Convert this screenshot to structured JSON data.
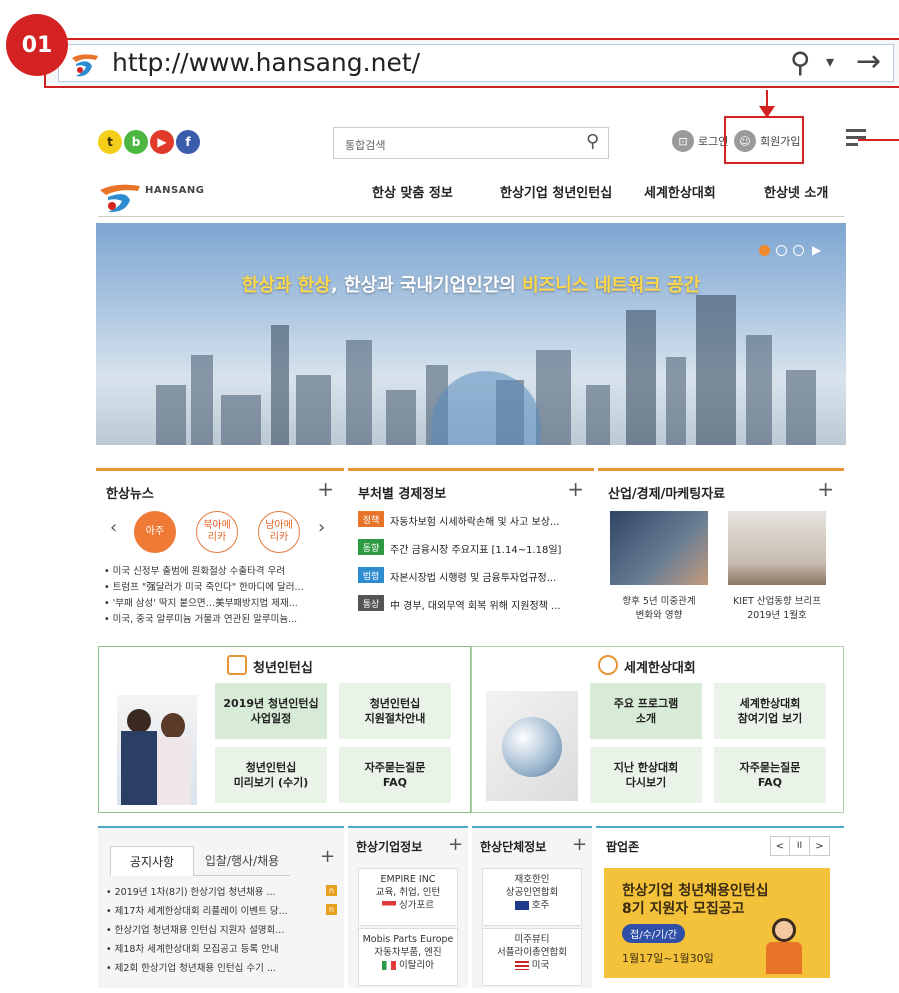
{
  "annotation": {
    "step": "01"
  },
  "address_bar": {
    "url": "http://www.hansang.net/"
  },
  "header": {
    "search_label": "통합검색",
    "login_label": "로그인",
    "signup_label": "회원가입",
    "logo_text": "HANSANG",
    "nav": [
      "한상 맞춤 정보",
      "한상기업 청년인턴십",
      "세계한상대회",
      "한상넷 소개"
    ]
  },
  "banner": {
    "part1": "한상과 한상",
    "part2": ", 한상과 국내기업인간의 ",
    "part3": "비즈니스 네트워크 공간"
  },
  "news_panel": {
    "title": "한상뉴스",
    "regions": [
      "아주",
      "북아메\n리카",
      "남아메\n리카"
    ],
    "items": [
      "• 미국 신정부 출범에 원화절상 수출타격 우려",
      "• 트럼프 \"强달러가 미국 죽인다\" 한마디에 달러...",
      "• '부패 삼성' 딱지 붙으면…美부패방지법 제재...",
      "• 미국, 중국 알루미늄 거물과 연관된 알루미늄..."
    ]
  },
  "econ_panel": {
    "title": "부처별 경제정보",
    "items": [
      {
        "tag": "정책",
        "color": "#e8742a",
        "text": "자동차보험 시세하락손해 및 사고 보상..."
      },
      {
        "tag": "동향",
        "color": "#2f9a44",
        "text": "주간 금융시장 주요지표 [1.14~1.18일]"
      },
      {
        "tag": "법령",
        "color": "#2d8bd0",
        "text": "자본시장법 시행령 및 금융투자업규정..."
      },
      {
        "tag": "통상",
        "color": "#555555",
        "text": "中 경부, 대외무역 회복 위해 지원정책 ..."
      }
    ]
  },
  "market_panel": {
    "title": "산업/경제/마케팅자료",
    "items": [
      {
        "caption": "향후 5년 미중관계\n변화와 영향"
      },
      {
        "caption": "KIET 산업동향 브리프\n2019년 1월호"
      }
    ]
  },
  "intern_box": {
    "title": "청년인턴십",
    "buttons": [
      "2019년 청년인턴십\n사업일정",
      "청년인턴십\n지원절차안내",
      "청년인턴십\n미리보기 (수기)",
      "자주묻는질문\nFAQ"
    ]
  },
  "convention_box": {
    "title": "세계한상대회",
    "buttons": [
      "주요 프로그램\n소개",
      "세계한상대회\n참여기업 보기",
      "지난 한상대회\n다시보기",
      "자주묻는질문\nFAQ"
    ]
  },
  "notice_panel": {
    "tabs": [
      "공지사항",
      "입찰/행사/채용"
    ],
    "new_badge": "n",
    "items": [
      "• 2019년 1차(8기) 한상기업 청년채용 ...",
      "• 제17차 세계한상대회 리플레이 이벤트 당...",
      "• 한상기업 청년채용 인턴십 지원자 설명회...",
      "• 제18차 세계한상대회 모집공고 등록 안내",
      "• 제2회 한상기업 청년채용 인턴십 수기 ..."
    ]
  },
  "company_panel": {
    "title": "한상기업정보",
    "cards": [
      {
        "name": "EMPIRE INC",
        "desc": "교육, 취업, 인턴",
        "country": "싱가포르"
      },
      {
        "name": "Mobis Parts Europe",
        "desc": "자동차부품, 엔진",
        "country": "이탈리아"
      }
    ]
  },
  "group_panel": {
    "title": "한상단체정보",
    "cards": [
      {
        "name": "재호한인",
        "desc": "상공인연합회",
        "country": "호주"
      },
      {
        "name": "미주뷰티",
        "desc": "서플라이총연합회",
        "country": "미국"
      }
    ]
  },
  "popup_panel": {
    "title": "팝업존",
    "controls": [
      "<",
      "II",
      ">"
    ],
    "headline1": "한상기업 청년채용인턴십",
    "headline2": "8기 지원자 모집공고",
    "pill": "접/수/기/간",
    "period": "1월17일~1월30일"
  },
  "colors": {
    "accent": "#d42222",
    "orange": "#e8953a",
    "green": "#9fcb9a",
    "teal": "#4aa8c8"
  }
}
